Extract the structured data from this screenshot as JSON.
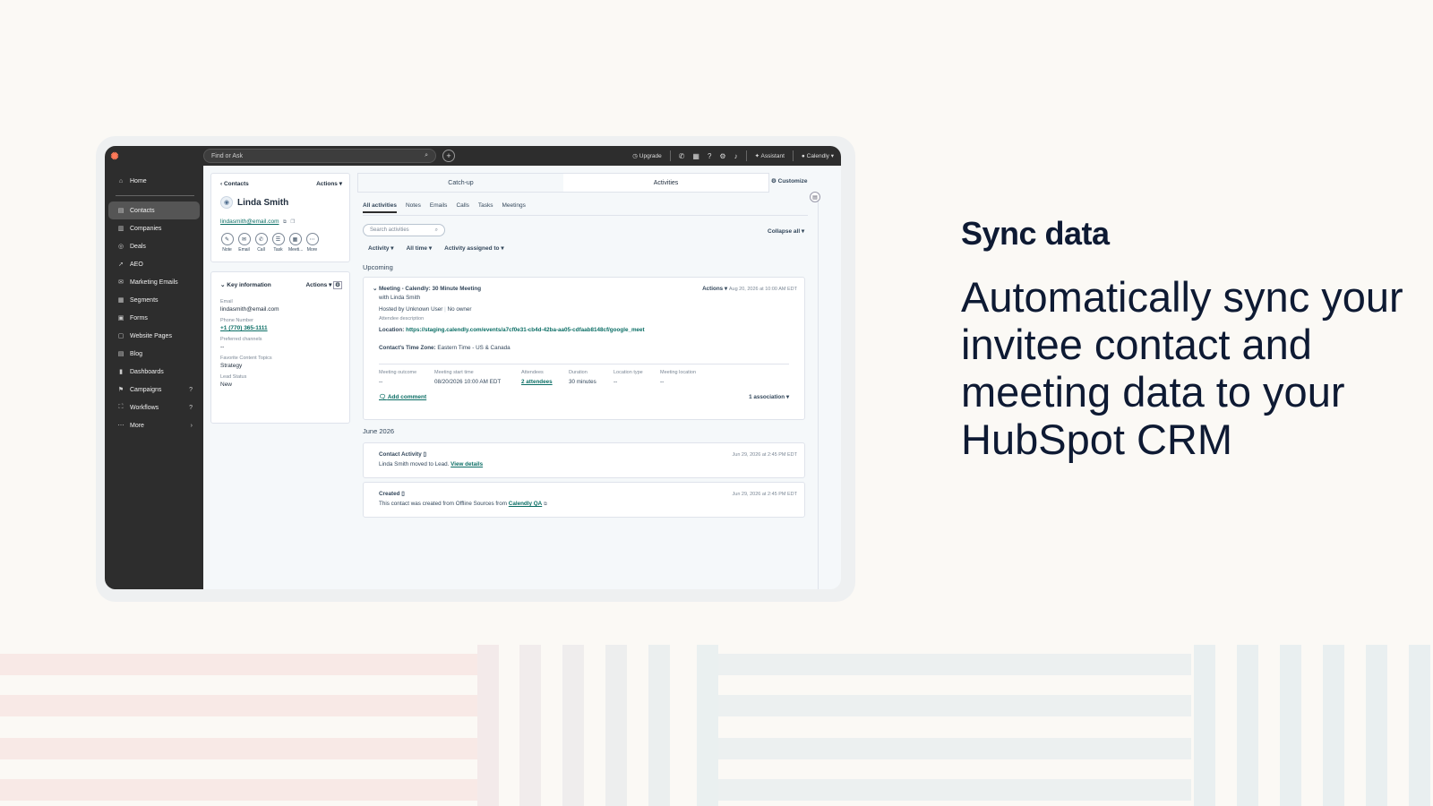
{
  "hero": {
    "title": "Sync data",
    "body": "Automatically sync your invitee contact and meeting data to your HubSpot CRM"
  },
  "topbar": {
    "search_placeholder": "Find or Ask",
    "upgrade": "Upgrade",
    "assistant": "Assistant",
    "account": "Calendly"
  },
  "sidebar": {
    "home": "Home",
    "items": [
      {
        "label": "Contacts",
        "icon": "▤"
      },
      {
        "label": "Companies",
        "icon": "▥"
      },
      {
        "label": "Deals",
        "icon": "◎"
      },
      {
        "label": "AEO",
        "icon": "➚"
      },
      {
        "label": "Marketing Emails",
        "icon": "✉"
      },
      {
        "label": "Segments",
        "icon": "▦"
      },
      {
        "label": "Forms",
        "icon": "▣"
      },
      {
        "label": "Website Pages",
        "icon": "▢"
      },
      {
        "label": "Blog",
        "icon": "▤"
      },
      {
        "label": "Dashboards",
        "icon": "▮"
      },
      {
        "label": "Campaigns",
        "icon": "⚑"
      },
      {
        "label": "Workflows",
        "icon": "⛶"
      },
      {
        "label": "More",
        "icon": "⋯"
      }
    ]
  },
  "contact": {
    "breadcrumb": "Contacts",
    "actions": "Actions",
    "name": "Linda Smith",
    "email": "lindasmith@email.com",
    "quick_actions": [
      "Note",
      "Email",
      "Call",
      "Task",
      "Meeti...",
      "More"
    ]
  },
  "key_info": {
    "title": "Key information",
    "actions": "Actions",
    "fields": [
      {
        "label": "Email",
        "value": "lindasmith@email.com"
      },
      {
        "label": "Phone Number",
        "value": "+1 (770) 365-1111"
      },
      {
        "label": "Preferred channels",
        "value": "--"
      },
      {
        "label": "Favorite Content Topics",
        "value": "Strategy"
      },
      {
        "label": "Lead Status",
        "value": "New"
      }
    ]
  },
  "main": {
    "tabs": [
      "Catch-up",
      "Activities"
    ],
    "customize": "Customize",
    "subtabs": [
      "All activities",
      "Notes",
      "Emails",
      "Calls",
      "Tasks",
      "Meetings"
    ],
    "search_placeholder": "Search activities",
    "collapse": "Collapse all",
    "filters": [
      "Activity",
      "All time",
      "Activity assigned to"
    ],
    "upcoming": "Upcoming",
    "june": "June 2026"
  },
  "meeting": {
    "title": "Meeting - Calendly: 30 Minute Meeting",
    "actions": "Actions",
    "date": "Aug 20, 2026 at 10:00 AM EDT",
    "with": "with Linda Smith",
    "hosted": "Hosted by Unknown User",
    "owner": "No owner",
    "attendee_desc": "Attendee description",
    "location_label": "Location:",
    "location_url": "https://staging.calendly.com/events/a7cf0e31-cb4d-42ba-aa05-cdfaab8148cf/google_meet",
    "tz_label": "Contact's Time Zone:",
    "tz_value": "Eastern Time - US & Canada",
    "grid": [
      {
        "label": "Meeting outcome",
        "value": "--"
      },
      {
        "label": "Meeting start time",
        "value": "08/20/2026 10:00 AM EDT"
      },
      {
        "label": "Attendees",
        "value": "2 attendees"
      },
      {
        "label": "Duration",
        "value": "30 minutes"
      },
      {
        "label": "Location type",
        "value": "--"
      },
      {
        "label": "Meeting location",
        "value": "--"
      }
    ],
    "add_comment": "Add comment",
    "association": "1 association"
  },
  "contact_activity": {
    "title": "Contact Activity",
    "date": "Jun 29, 2026 at 2:45 PM EDT",
    "text": "Linda Smith moved to Lead.",
    "link": "View details"
  },
  "created": {
    "title": "Created",
    "date": "Jun 29, 2026 at 2:45 PM EDT",
    "text": "This contact was created from Offline Sources from",
    "link": "Calendly QA"
  },
  "colors": {
    "accent": "#0b6e65",
    "logo": "#ff7a59",
    "nav": "#2d2d2d",
    "heading": "#0e1a33"
  }
}
